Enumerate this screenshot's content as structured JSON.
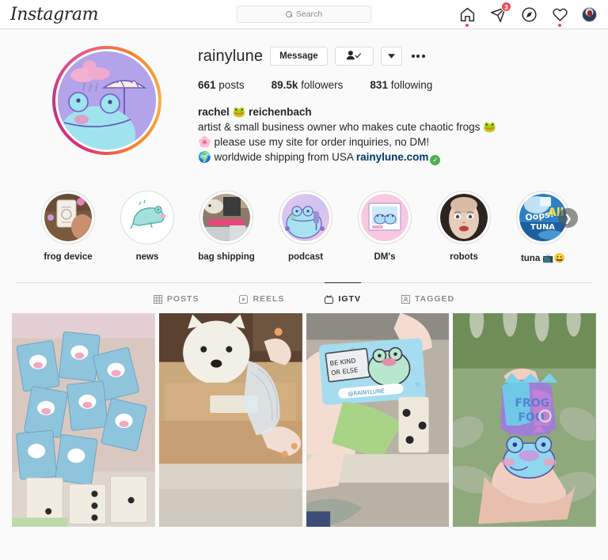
{
  "nav": {
    "logo": "Instagram",
    "search": {
      "placeholder": "Search",
      "value": "",
      "icon": "search-icon"
    },
    "icons": [
      {
        "name": "home-icon",
        "label": "Home",
        "has_dot": true
      },
      {
        "name": "messenger-icon",
        "label": "Messenger",
        "badge": "3"
      },
      {
        "name": "explore-icon",
        "label": "Explore"
      },
      {
        "name": "activity-heart-icon",
        "label": "Activity",
        "has_dot": true
      },
      {
        "name": "profile-avatar",
        "label": "Profile"
      }
    ]
  },
  "profile": {
    "username": "rainylune",
    "avatar_has_story_ring": true,
    "actions": {
      "message_label": "Message",
      "following_icon": "person-check-icon",
      "dropdown_icon": "chevron-down-icon",
      "options_icon": "more-options-icon"
    },
    "stats": [
      {
        "value": "661",
        "label": "posts"
      },
      {
        "value": "89.5k",
        "label": "followers"
      },
      {
        "value": "831",
        "label": "following"
      }
    ],
    "bio": {
      "display_name": "rachel 🐸 reichenbach",
      "line1": "artist & small business owner who makes cute chaotic frogs 🐸",
      "line2": "🌸 please use my site for order inquiries, no DM!",
      "line3_prefix": "🌍 worldwide shipping from USA",
      "link": "rainylune.com",
      "link_verified": true,
      "link_color": "#00376b"
    }
  },
  "highlights": [
    {
      "label": "frog device"
    },
    {
      "label": "news"
    },
    {
      "label": "bag shipping"
    },
    {
      "label": "podcast"
    },
    {
      "label": "DM's"
    },
    {
      "label": "robots"
    },
    {
      "label": "tuna 📺😀"
    }
  ],
  "highlights_next_icon": "chevron-right-icon",
  "tabs": [
    {
      "label": "POSTS",
      "icon": "grid-icon",
      "active": false
    },
    {
      "label": "REELS",
      "icon": "reels-icon",
      "active": false
    },
    {
      "label": "IGTV",
      "icon": "igtv-icon",
      "active": true
    },
    {
      "label": "TAGGED",
      "icon": "tagged-person-icon",
      "active": false
    }
  ],
  "posts": [
    {
      "alt": "pile of blue frog enamel pin backing cards in a box"
    },
    {
      "alt": "white westie dog behind a cardboard shipping box with hands packing"
    },
    {
      "alt": "hand holding a blue be kind or else frog pin card"
    },
    {
      "alt": "hand holding a blue and purple frog acrylic keychain over plants"
    }
  ],
  "colors": {
    "page_bg": "#fafafa",
    "nav_bg": "#ffffff",
    "border": "#dbdbdb",
    "text": "#262626",
    "muted": "#8e8e8e",
    "notification": "#ed4956",
    "link": "#00376b",
    "verified": "#4caf50"
  }
}
